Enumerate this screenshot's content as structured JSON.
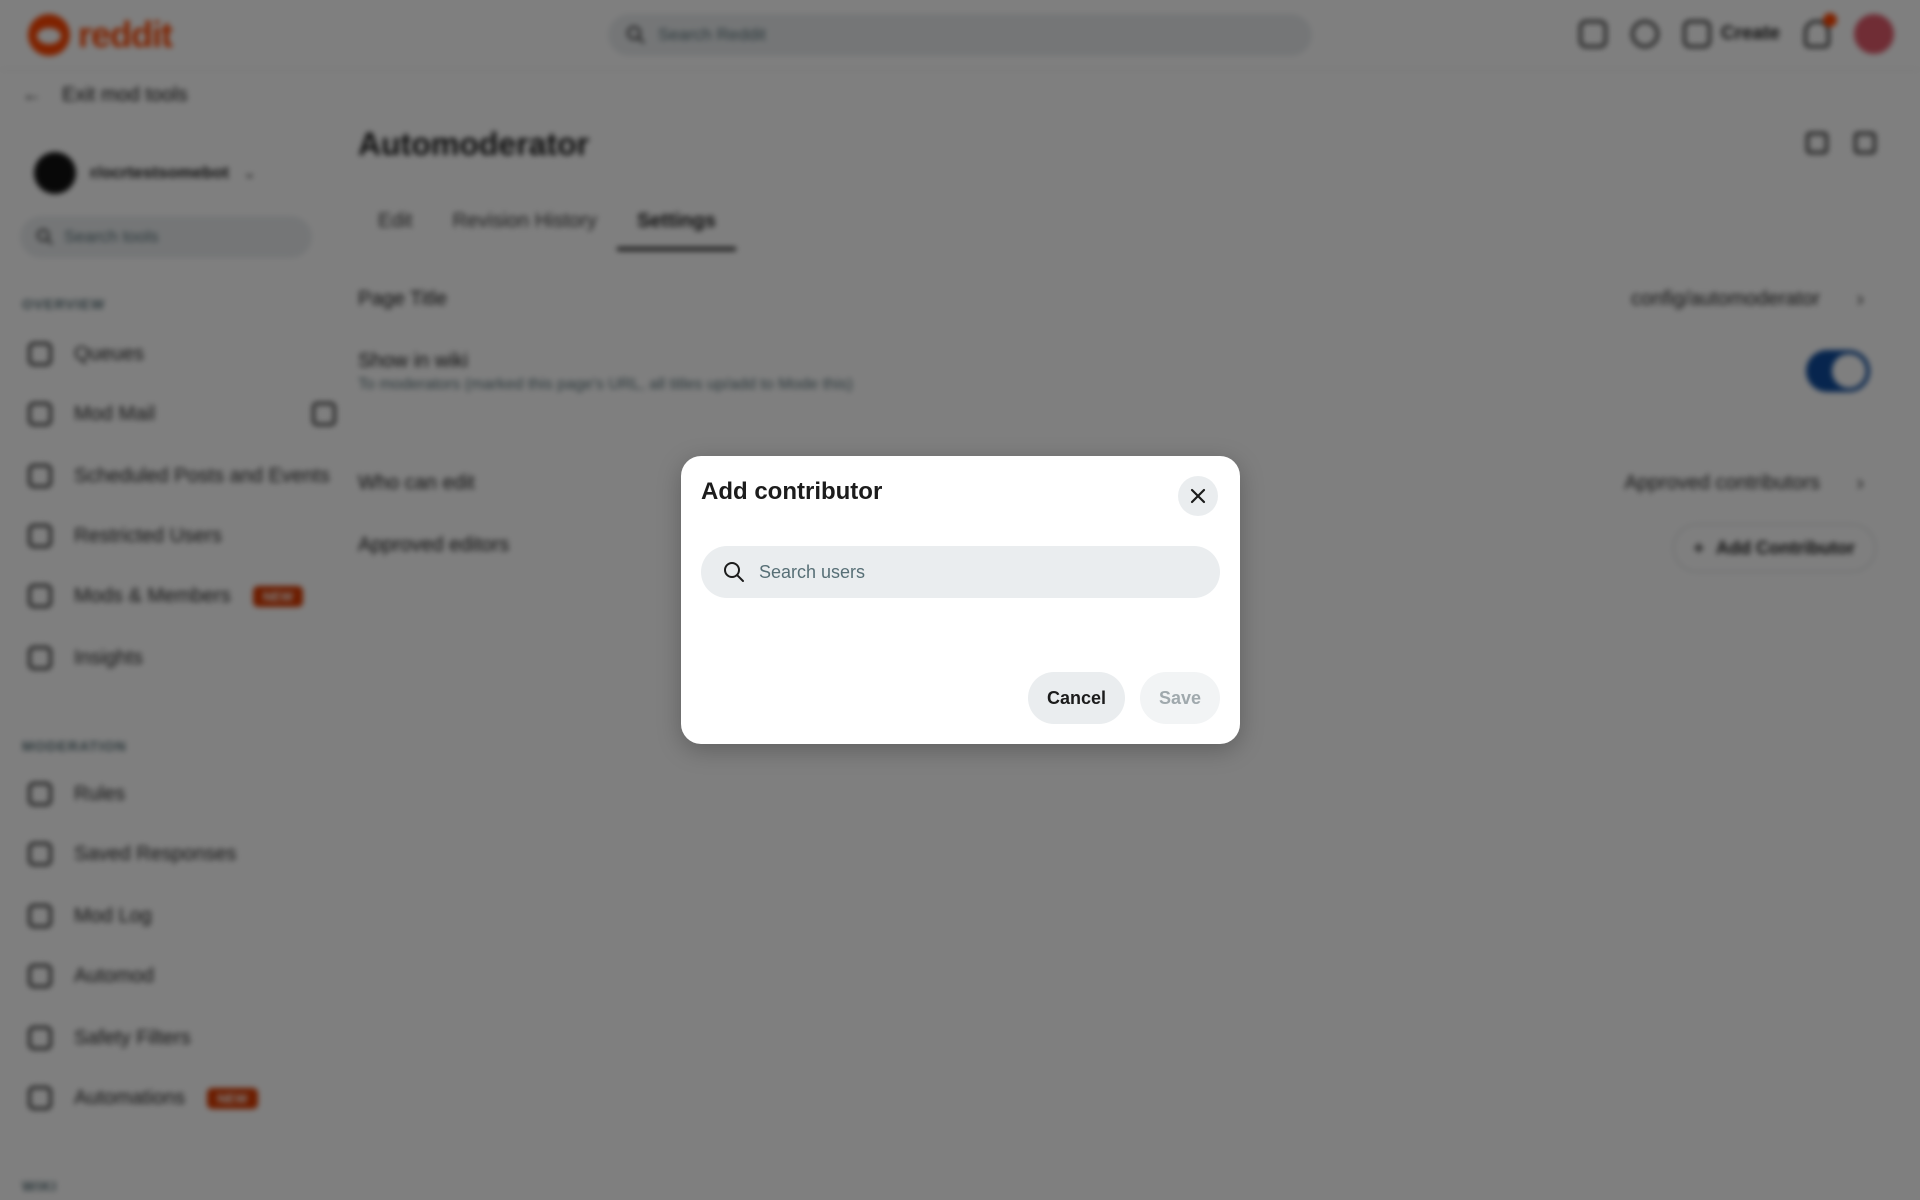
{
  "header": {
    "logo_text": "reddit",
    "search_placeholder": "Search Reddit",
    "create_label": "Create"
  },
  "sidebar": {
    "exit_label": "Exit mod tools",
    "community_name": "r/ocrtestsomebot",
    "tool_search_placeholder": "Search tools",
    "overview_label": "OVERVIEW",
    "overview_items": [
      {
        "label": "Queues"
      },
      {
        "label": "Mod Mail"
      },
      {
        "label": "Scheduled Posts and Events"
      },
      {
        "label": "Restricted Users"
      },
      {
        "label": "Mods & Members",
        "badge": "NEW"
      },
      {
        "label": "Insights"
      }
    ],
    "moderation_label": "MODERATION",
    "moderation_items": [
      {
        "label": "Rules"
      },
      {
        "label": "Saved Responses"
      },
      {
        "label": "Mod Log"
      },
      {
        "label": "Automod"
      },
      {
        "label": "Safety Filters"
      },
      {
        "label": "Automations",
        "badge": "NEW"
      }
    ],
    "wiki_label": "WIKI"
  },
  "main": {
    "page_title": "Automoderator",
    "tabs": [
      {
        "label": "Edit"
      },
      {
        "label": "Revision History"
      },
      {
        "label": "Settings",
        "active": true
      }
    ],
    "settings": {
      "page_title_label": "Page Title",
      "page_title_value": "config/automoderator",
      "show_in_wiki_label": "Show in wiki",
      "show_in_wiki_desc": "To moderators (marked this page's URL, all titles up/add to Mode this)",
      "show_in_wiki_enabled": true,
      "who_can_edit_label": "Who can edit",
      "who_can_edit_value": "Approved contributors",
      "approved_editors_label": "Approved editors",
      "add_contributor_button": "Add Contributor"
    }
  },
  "modal": {
    "title": "Add contributor",
    "search_placeholder": "Search users",
    "search_value": "",
    "cancel_label": "Cancel",
    "save_label": "Save",
    "save_enabled": false
  },
  "colors": {
    "brand": "#ff4500",
    "badge": "#d93a00",
    "toggle_on": "#0e4b9c",
    "overlay": "rgba(0,0,0,0.5)"
  }
}
